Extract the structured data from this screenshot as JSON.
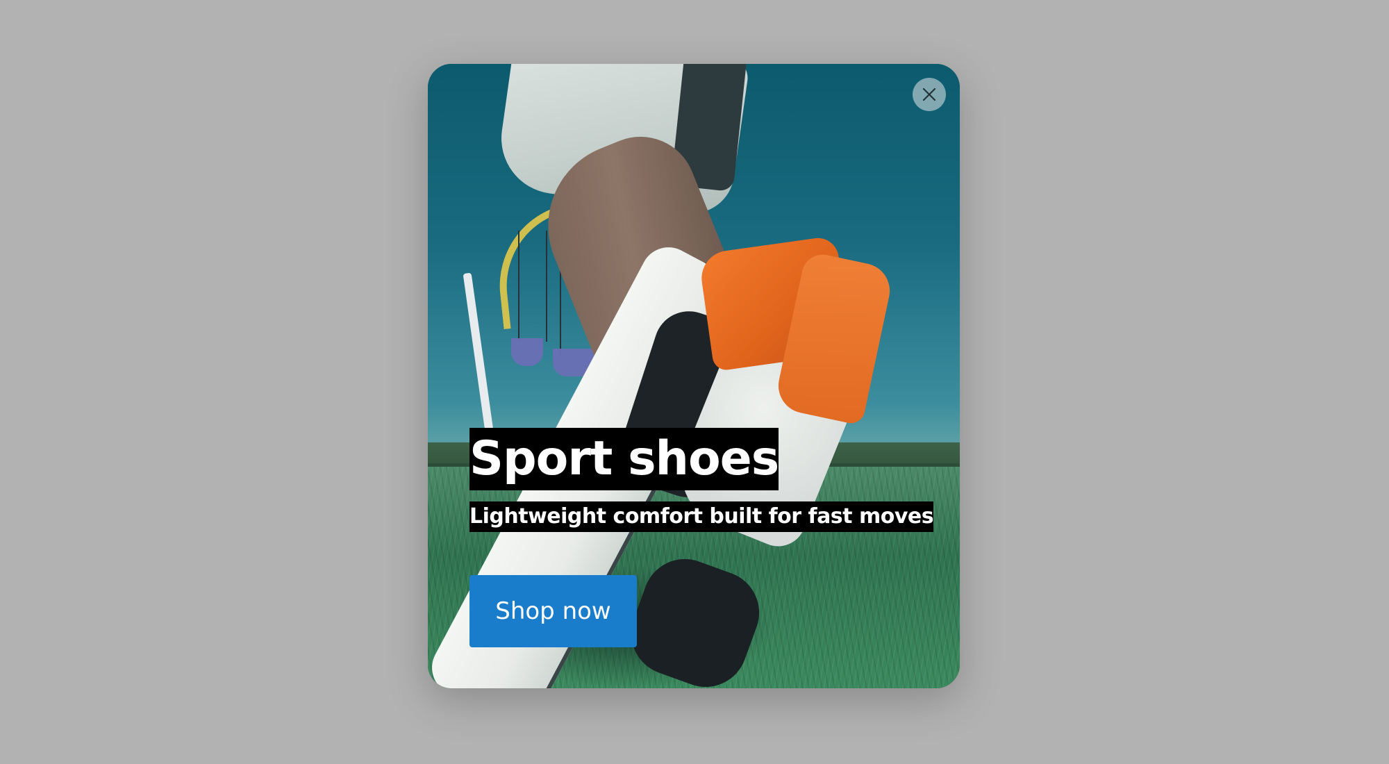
{
  "popup": {
    "title": "Sport shoes",
    "subtitle": "Lightweight comfort built for fast moves",
    "cta_label": "Shop now",
    "close_icon": "close-icon",
    "accent_color": "#1a7dcc",
    "background_image": "sneaker-on-grass-photo"
  }
}
